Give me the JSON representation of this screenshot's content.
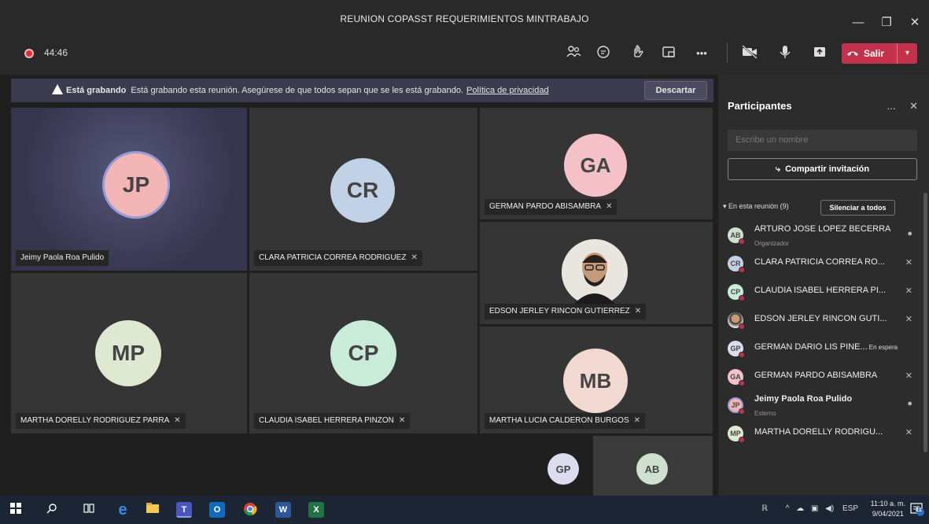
{
  "window": {
    "title": "REUNION COPASST REQUERIMIENTOS MINTRABAJO",
    "minimize_icon": "—",
    "maximize_icon": "❐",
    "close_icon": "✕"
  },
  "toolbar": {
    "timer": "44:46",
    "leave_label": "Salir"
  },
  "banner": {
    "bold_text": "Está grabando",
    "message": "Está grabando esta reunión. Asegúrese de que todos sepan que se les está grabando.",
    "link_text": "Política de privacidad",
    "dismiss_label": "Descartar"
  },
  "tiles": [
    {
      "initials": "JP",
      "name": "Jeimy Paola Roa Pulido",
      "color": "#f2b6b6"
    },
    {
      "initials": "CR",
      "name": "CLARA PATRICIA CORREA RODRIGUEZ",
      "color": "#c2d2e6"
    },
    {
      "initials": "GA",
      "name": "GERMAN PARDO ABISAMBRA",
      "color": "#f4c1c8"
    },
    {
      "initials": "",
      "name": "EDSON JERLEY RINCON GUTIERREZ",
      "color": "#8a6a50"
    },
    {
      "initials": "MP",
      "name": "MARTHA DORELLY RODRIGUEZ PARRA",
      "color": "#dfe9d2"
    },
    {
      "initials": "CP",
      "name": "CLAUDIA ISABEL HERRERA PINZON",
      "color": "#c9ecd9"
    },
    {
      "initials": "MB",
      "name": "MARTHA LUCIA CALDERON BURGOS",
      "color": "#f1d9d2"
    },
    {
      "initials": "GP",
      "name": "",
      "color": "#dcdcef"
    },
    {
      "initials": "AB",
      "name": "",
      "color": "#cfe0cf"
    }
  ],
  "panel": {
    "title": "Participantes",
    "more_icon": "...",
    "close_icon": "✕",
    "search_placeholder": "Escribe un nombre",
    "share_label": "Compartir invitación",
    "section_label": "En esta reunión (9)",
    "mute_all_label": "Silenciar a todos",
    "participants": [
      {
        "initials": "AB",
        "name": "ARTURO JOSE LOPEZ BECERRA",
        "role": "Organizador",
        "status": "",
        "color": "#cfe0cf"
      },
      {
        "initials": "CR",
        "name": "CLARA PATRICIA CORREA RO...",
        "role": "",
        "status": "",
        "color": "#c2d2e6"
      },
      {
        "initials": "CP",
        "name": "CLAUDIA ISABEL HERRERA PI...",
        "role": "",
        "status": "",
        "color": "#c9ecd9"
      },
      {
        "initials": "",
        "name": "EDSON JERLEY RINCON GUTI...",
        "role": "",
        "status": "",
        "color": "#8a6a50"
      },
      {
        "initials": "GP",
        "name": "GERMAN DARIO LIS PINE...",
        "role": "",
        "status": "En espera",
        "color": "#dcdcef"
      },
      {
        "initials": "GA",
        "name": "GERMAN PARDO ABISAMBRA",
        "role": "",
        "status": "",
        "color": "#f4c1c8"
      },
      {
        "initials": "JP",
        "name": "Jeimy Paola Roa Pulido",
        "role": "Externo",
        "status": "",
        "color": "#f2b6b6"
      },
      {
        "initials": "MP",
        "name": "MARTHA DORELLY RODRIGU...",
        "role": "",
        "status": "",
        "color": "#dfe9d2"
      }
    ]
  },
  "taskbar": {
    "language": "ESP",
    "time": "11:10 a. m.",
    "date": "9/04/2021",
    "notifications": "21"
  }
}
